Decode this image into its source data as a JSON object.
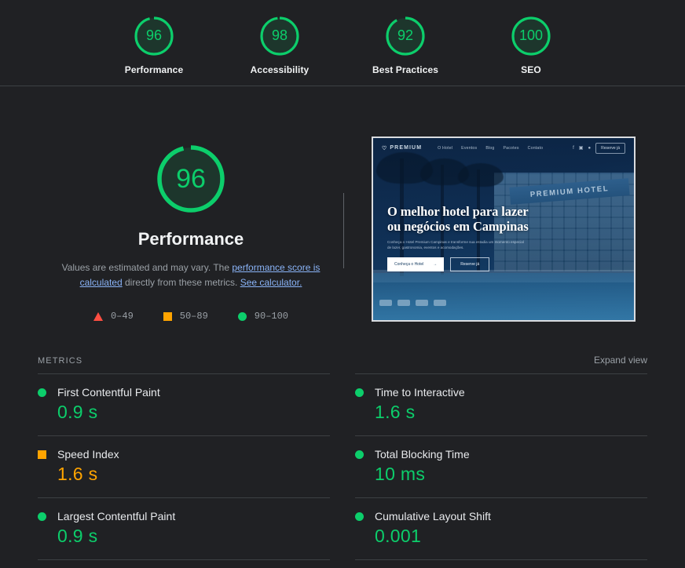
{
  "score_header": {
    "gauges": [
      {
        "score": 96,
        "label": "Performance",
        "color": "#0CCE6B"
      },
      {
        "score": 98,
        "label": "Accessibility",
        "color": "#0CCE6B"
      },
      {
        "score": 92,
        "label": "Best Practices",
        "color": "#0CCE6B"
      },
      {
        "score": 100,
        "label": "SEO",
        "color": "#0CCE6B"
      }
    ]
  },
  "category": {
    "score": 96,
    "title": "Performance",
    "description": {
      "part1": "Values are estimated and may vary. The ",
      "link1": "performance score is calculated",
      "part2": " directly from these metrics. ",
      "link2": "See calculator."
    },
    "legend": [
      {
        "shape": "triangle",
        "range": "0–49",
        "color": "#ff4e42"
      },
      {
        "shape": "square",
        "range": "50–89",
        "color": "#ffa400"
      },
      {
        "shape": "circle",
        "range": "90–100",
        "color": "#0CCE6B"
      }
    ]
  },
  "thumbnail": {
    "site_logo": "PREMIUM",
    "nav_links": [
      "O Hotel",
      "Eventos",
      "Blog",
      "Pacotes",
      "Contato"
    ],
    "social": [
      "f",
      "▣",
      "●"
    ],
    "header_cta": "Reserve já",
    "hero_heading_line1": "O melhor hotel para lazer",
    "hero_heading_line2": "ou negócios em Campinas",
    "hero_sub_line1": "Conheça o Hotel Premium Campinas e transforme sua estadia um momento",
    "hero_sub_line2": "especial de lazer, gastronomia, eventos e acomodações.",
    "hero_btn_primary": "Conheça o Hotel",
    "hero_btn_primary_arrow": "→",
    "hero_btn_secondary": "Reserve já",
    "building_sign": "PREMIUM HOTEL"
  },
  "metrics": {
    "section_title": "METRICS",
    "expand_view": "Expand view",
    "left_column": [
      {
        "name": "First Contentful Paint",
        "value": "0.9 s",
        "status": "pass"
      },
      {
        "name": "Speed Index",
        "value": "1.6 s",
        "status": "average"
      },
      {
        "name": "Largest Contentful Paint",
        "value": "0.9 s",
        "status": "pass"
      }
    ],
    "right_column": [
      {
        "name": "Time to Interactive",
        "value": "1.6 s",
        "status": "pass"
      },
      {
        "name": "Total Blocking Time",
        "value": "10 ms",
        "status": "pass"
      },
      {
        "name": "Cumulative Layout Shift",
        "value": "0.001",
        "status": "pass"
      }
    ]
  }
}
